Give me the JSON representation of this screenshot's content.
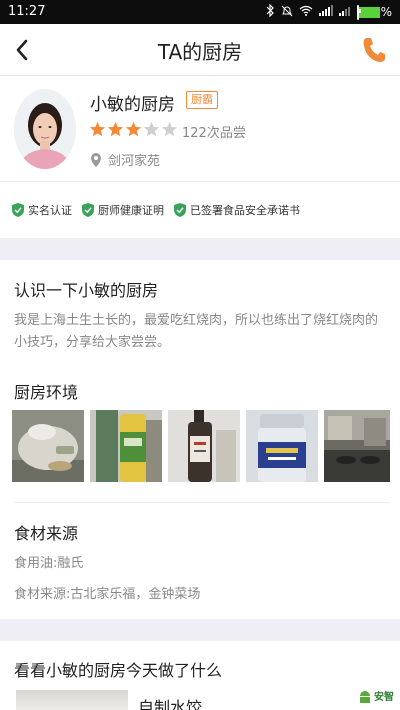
{
  "status_bar": {
    "time": "11:27",
    "battery": "94%"
  },
  "header": {
    "title": "TA的厨房"
  },
  "profile": {
    "name": "小敏的厨房",
    "badge": "厨霸",
    "rating_stars": 3,
    "rating_max": 5,
    "taste_count": "122次品尝",
    "location": "剑河家苑"
  },
  "certifications": [
    "实名认证",
    "厨师健康证明",
    "已签署食品安全承诺书"
  ],
  "intro": {
    "title": "认识一下小敏的厨房",
    "text": "我是上海土生土长的，最爱吃红烧肉，所以也练出了烧红烧肉的小技巧，分享给大家尝尝。"
  },
  "environment": {
    "title": "厨房环境"
  },
  "ingredients": {
    "title": "食材来源",
    "oil": "食用油:融氏",
    "source": "食材来源:古北家乐福，金钟菜场"
  },
  "today": {
    "title": "看看小敏的厨房今天做了什么",
    "dish_title": "自制水饺"
  },
  "watermark": "安智",
  "colors": {
    "accent": "#f08a38",
    "green": "#3aa35a",
    "star_off": "#cfcfcf"
  }
}
